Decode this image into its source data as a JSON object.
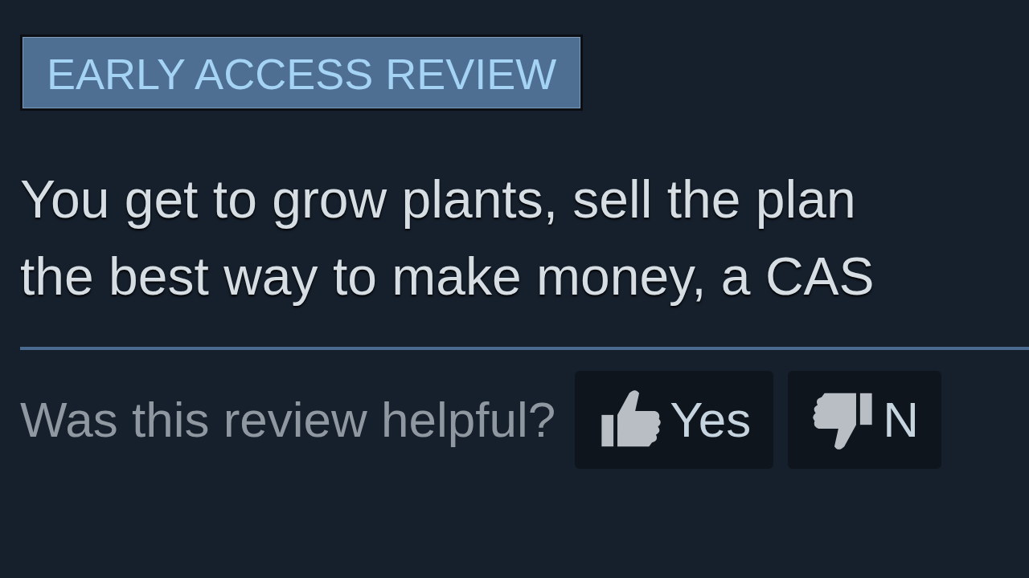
{
  "badge": "EARLY ACCESS REVIEW",
  "review_lines": [
    "You get to grow plants, sell the plan",
    "the best way to make money, a CAS"
  ],
  "helpful": {
    "prompt": "Was this review helpful?",
    "buttons": [
      {
        "kind": "thumbs_up",
        "label": "Yes"
      },
      {
        "kind": "thumbs_down",
        "label": "N"
      }
    ]
  }
}
